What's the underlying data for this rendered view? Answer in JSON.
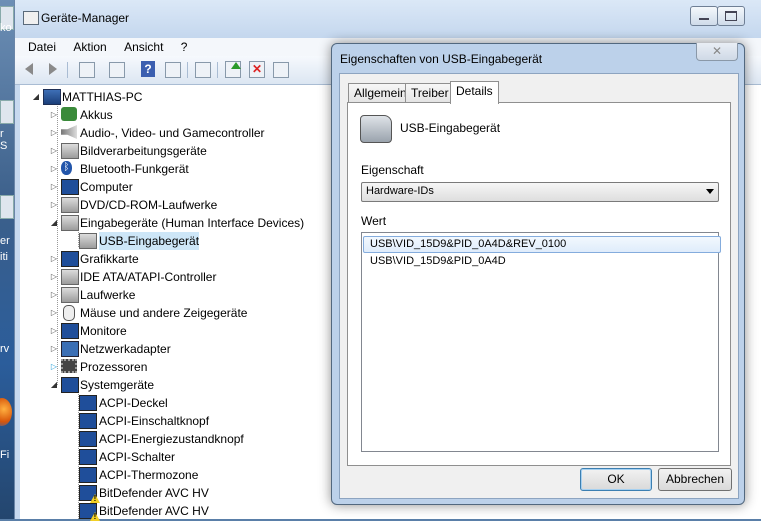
{
  "desktop": {
    "fragments": [
      "ko",
      "r S",
      "er",
      "iti",
      "rv",
      "Fi"
    ]
  },
  "window": {
    "title": "Geräte-Manager",
    "menu": [
      "Datei",
      "Aktion",
      "Ansicht",
      "?"
    ],
    "toolbar_icons": [
      "back-arrow-icon",
      "forward-arrow-icon",
      "show-hide-tree-icon",
      "properties-icon",
      "help-icon",
      "view-icon",
      "scan-hardware-icon",
      "update-driver-icon",
      "uninstall-icon",
      "disable-icon"
    ]
  },
  "tree": {
    "root": "MATTHIAS-PC",
    "items": [
      {
        "label": "Akkus",
        "icon": "battery-icon"
      },
      {
        "label": "Audio-, Video- und Gamecontroller",
        "icon": "speaker-icon"
      },
      {
        "label": "Bildverarbeitungsgeräte",
        "icon": "camera-icon"
      },
      {
        "label": "Bluetooth-Funkgerät",
        "icon": "bluetooth-icon"
      },
      {
        "label": "Computer",
        "icon": "computer-icon"
      },
      {
        "label": "DVD/CD-ROM-Laufwerke",
        "icon": "dvd-drive-icon"
      },
      {
        "label": "Eingabegeräte (Human Interface Devices)",
        "icon": "hid-icon"
      },
      {
        "label": "USB-Eingabegerät",
        "icon": "hid-device-icon"
      },
      {
        "label": "Grafikkarte",
        "icon": "display-adapter-icon"
      },
      {
        "label": "IDE ATA/ATAPI-Controller",
        "icon": "ide-controller-icon"
      },
      {
        "label": "Laufwerke",
        "icon": "disk-drive-icon"
      },
      {
        "label": "Mäuse und andere Zeigegeräte",
        "icon": "mouse-icon"
      },
      {
        "label": "Monitore",
        "icon": "monitor-icon"
      },
      {
        "label": "Netzwerkadapter",
        "icon": "network-adapter-icon"
      },
      {
        "label": "Prozessoren",
        "icon": "processor-icon"
      },
      {
        "label": "Systemgeräte",
        "icon": "system-devices-icon"
      },
      {
        "label": "ACPI-Deckel",
        "icon": "system-device-icon"
      },
      {
        "label": "ACPI-Einschaltknopf",
        "icon": "system-device-icon"
      },
      {
        "label": "ACPI-Energiezustandknopf",
        "icon": "system-device-icon"
      },
      {
        "label": "ACPI-Schalter",
        "icon": "system-device-icon"
      },
      {
        "label": "ACPI-Thermozone",
        "icon": "system-device-icon"
      },
      {
        "label": "BitDefender AVC HV",
        "icon": "warning-device-icon"
      },
      {
        "label": "BitDefender AVC HV",
        "icon": "warning-device-icon"
      }
    ]
  },
  "dialog": {
    "title": "Eigenschaften von USB-Eingabegerät",
    "close": "✕",
    "tabs": [
      "Allgemein",
      "Treiber",
      "Details"
    ],
    "active_tab": "Details",
    "device_name": "USB-Eingabegerät",
    "property_label": "Eigenschaft",
    "property_value": "Hardware-IDs",
    "value_label": "Wert",
    "values": [
      "USB\\VID_15D9&PID_0A4D&REV_0100",
      "USB\\VID_15D9&PID_0A4D"
    ],
    "ok": "OK",
    "cancel": "Abbrechen"
  },
  "colors": {
    "title_bar": "#c4d7ee",
    "selection": "#cde6f7",
    "list_highlight": "#dfecfb"
  }
}
